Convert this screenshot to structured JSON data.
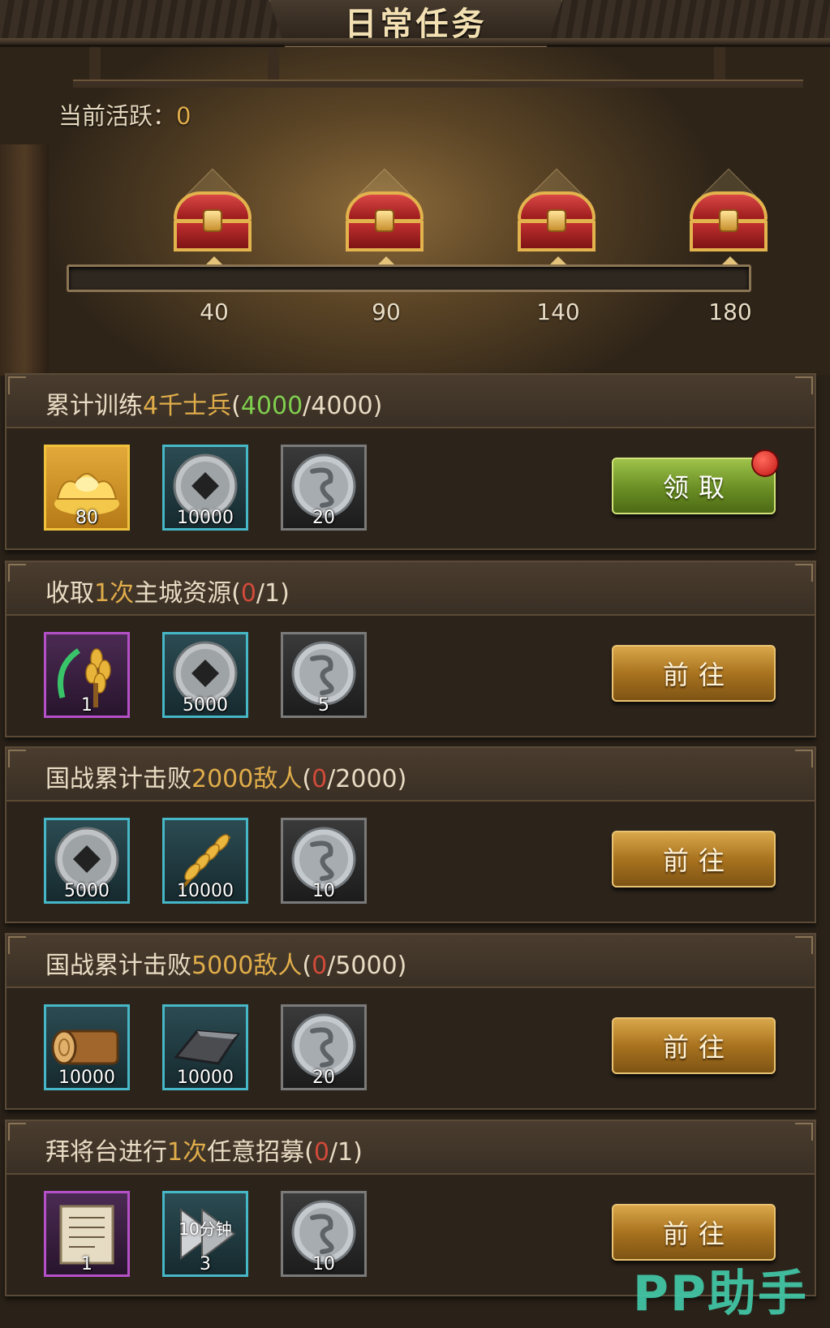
{
  "header": {
    "title": "日常任务"
  },
  "activity": {
    "label": "当前活跃：",
    "value": "0",
    "progress_fraction": 0
  },
  "milestones": [
    {
      "value": "40"
    },
    {
      "value": "90"
    },
    {
      "value": "140"
    },
    {
      "value": "180"
    }
  ],
  "tasks": [
    {
      "title_pre": "累计训练",
      "title_hl": "4千士兵",
      "title_post": "(",
      "current": "4000",
      "sep": "/",
      "total": "4000",
      "close": ")",
      "button": "领取",
      "rewards": [
        {
          "icon": "gold-ingot-icon",
          "qty": "80"
        },
        {
          "icon": "copper-coin-icon",
          "qty": "10000"
        },
        {
          "icon": "dragon-coin-icon",
          "qty": "20"
        }
      ]
    },
    {
      "title_pre": "收取",
      "title_hl": "1次",
      "title_post": "主城资源(",
      "current": "0",
      "sep": "/",
      "total": "1",
      "close": ")",
      "button": "前往",
      "rewards": [
        {
          "icon": "harvest-sickle-icon",
          "qty": "1"
        },
        {
          "icon": "copper-coin-icon",
          "qty": "5000"
        },
        {
          "icon": "dragon-coin-icon",
          "qty": "5"
        }
      ]
    },
    {
      "title_pre": "国战累计击败",
      "title_hl": "2000敌人",
      "title_post": "(",
      "current": "0",
      "sep": "/",
      "total": "2000",
      "close": ")",
      "button": "前往",
      "rewards": [
        {
          "icon": "copper-coin-icon",
          "qty": "5000"
        },
        {
          "icon": "wheat-icon",
          "qty": "10000"
        },
        {
          "icon": "dragon-coin-icon",
          "qty": "10"
        }
      ]
    },
    {
      "title_pre": "国战累计击败",
      "title_hl": "5000敌人",
      "title_post": "(",
      "current": "0",
      "sep": "/",
      "total": "5000",
      "close": ")",
      "button": "前往",
      "rewards": [
        {
          "icon": "wood-log-icon",
          "qty": "10000"
        },
        {
          "icon": "iron-ingot-icon",
          "qty": "10000"
        },
        {
          "icon": "dragon-coin-icon",
          "qty": "20"
        }
      ]
    },
    {
      "title_pre": "拜将台进行",
      "title_hl": "1次",
      "title_post": "任意招募(",
      "current": "0",
      "sep": "/",
      "total": "1",
      "close": ")",
      "button": "前往",
      "rewards": [
        {
          "icon": "scroll-icon",
          "qty": "1"
        },
        {
          "icon": "speedup-icon",
          "qty": "3",
          "sub": "10分钟"
        },
        {
          "icon": "dragon-coin-icon",
          "qty": "10"
        }
      ]
    }
  ],
  "watermark": "PP助手",
  "colors": {
    "highlight": "#e0ad4a",
    "complete": "#7fcf4e",
    "incomplete": "#d24a3a"
  }
}
